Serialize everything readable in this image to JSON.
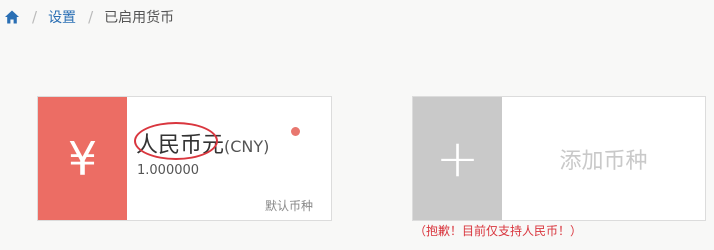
{
  "breadcrumb": {
    "items": [
      "设置",
      "已启用货币"
    ],
    "separator": "/"
  },
  "currency_card": {
    "symbol": "¥",
    "name": "人民币元",
    "code": "(CNY)",
    "rate": "1.000000",
    "default_label": "默认币种",
    "accent_color": "#ec6d64"
  },
  "add_card": {
    "plus": "+",
    "label": "添加币种"
  },
  "notice": "（抱歉！目前仅支持人民币！）",
  "icons": {
    "home": "home-icon",
    "status": "status-dot"
  }
}
